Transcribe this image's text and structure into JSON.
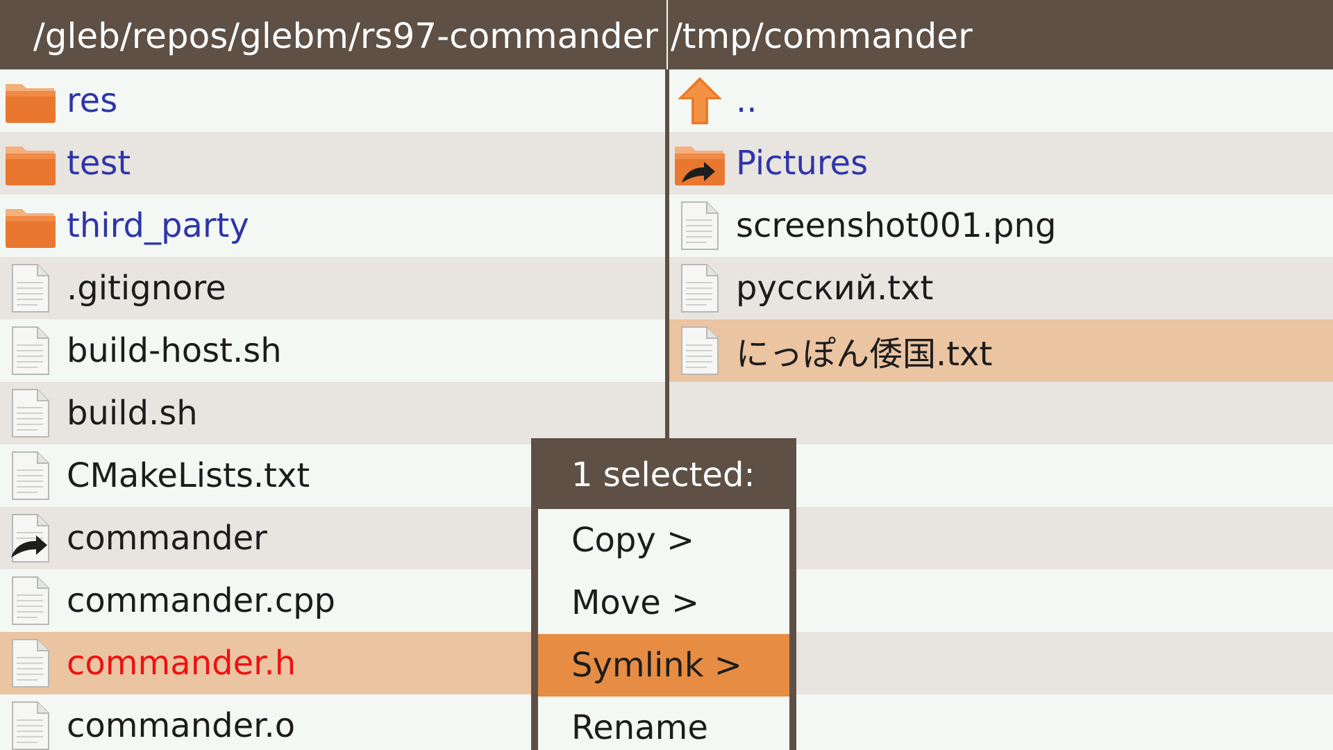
{
  "left_pane": {
    "path": "/gleb/repos/glebm/rs97-commander",
    "entries": [
      {
        "name": "res",
        "kind": "dir"
      },
      {
        "name": "test",
        "kind": "dir"
      },
      {
        "name": "third_party",
        "kind": "dir"
      },
      {
        "name": ".gitignore",
        "kind": "file"
      },
      {
        "name": "build-host.sh",
        "kind": "file"
      },
      {
        "name": "build.sh",
        "kind": "file"
      },
      {
        "name": "CMakeLists.txt",
        "kind": "file"
      },
      {
        "name": "commander",
        "kind": "symlink"
      },
      {
        "name": "commander.cpp",
        "kind": "file"
      },
      {
        "name": "commander.h",
        "kind": "file",
        "marked": true,
        "cursor": true
      },
      {
        "name": "commander.o",
        "kind": "file"
      }
    ]
  },
  "right_pane": {
    "path": "/tmp/commander",
    "entries": [
      {
        "name": "..",
        "kind": "up"
      },
      {
        "name": "Pictures",
        "kind": "dir-symlink"
      },
      {
        "name": "screenshot001.png",
        "kind": "file"
      },
      {
        "name": "русский.txt",
        "kind": "file"
      },
      {
        "name": "にっぽん倭国.txt",
        "kind": "file",
        "cursor": true
      }
    ]
  },
  "context_menu": {
    "title": "1 selected:",
    "items": [
      {
        "label": "Copy >"
      },
      {
        "label": "Move >"
      },
      {
        "label": "Symlink >",
        "active": true
      },
      {
        "label": "Rename"
      }
    ]
  },
  "colors": {
    "header": "#5e5045",
    "row_light": "#f4f8f4",
    "row_dark": "#e8e4e0",
    "cursor_row": "#ebc4a2",
    "menu_active": "#e68d43",
    "dir_text": "#2d35a8",
    "marked_text": "#ee1111"
  },
  "icons": {
    "dir": "folder-icon",
    "file": "file-icon",
    "symlink": "symlink-file-icon",
    "dir-symlink": "symlink-folder-icon",
    "up": "up-arrow-icon"
  }
}
